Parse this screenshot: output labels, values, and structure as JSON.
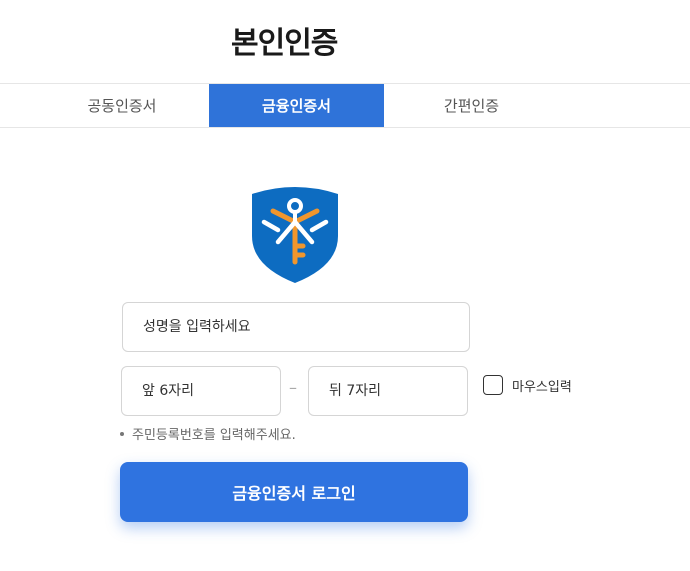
{
  "page": {
    "title": "본인인증"
  },
  "tabs": [
    {
      "label": "공동인증서",
      "active": false
    },
    {
      "label": "금융인증서",
      "active": true
    },
    {
      "label": "간편인증",
      "active": false
    }
  ],
  "form": {
    "name_placeholder": "성명을 입력하세요",
    "rrn_front_placeholder": "앞 6자리",
    "rrn_separator": "–",
    "rrn_back_placeholder": "뒤 7자리",
    "mouse_input_label": "마우스입력",
    "mouse_input_checked": false,
    "helper_text": "주민등록번호를 입력해주세요.",
    "submit_label": "금융인증서 로그인"
  },
  "logo": {
    "icon": "financial-certificate-key-shield-icon"
  },
  "colors": {
    "accent": "#2f73e0",
    "active_tab": "#2f73d9",
    "shield_blue": "#0d6cc1",
    "key_orange": "#f0962d"
  }
}
